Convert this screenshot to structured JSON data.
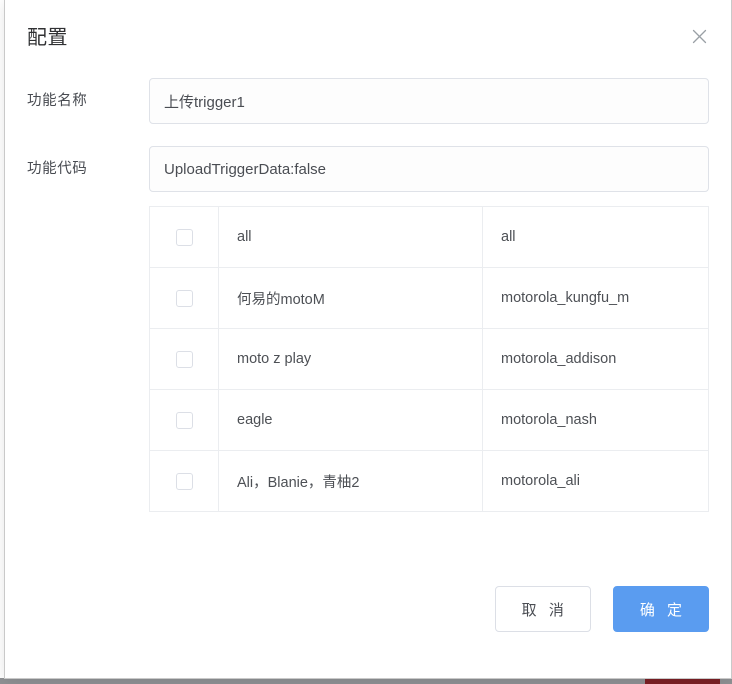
{
  "dialog": {
    "title": "配置",
    "close_icon": "close-icon"
  },
  "form": {
    "fields": [
      {
        "label": "功能名称",
        "value": "上传trigger1",
        "placeholder": "请输入功能名称",
        "name": "function-name"
      },
      {
        "label": "功能代码",
        "value": "UploadTriggerData:false",
        "placeholder": "请输入功能代码",
        "name": "function-code"
      }
    ]
  },
  "table": {
    "rows": [
      {
        "checked": false,
        "name": "all",
        "code": "all"
      },
      {
        "checked": false,
        "name": "何易的motoM",
        "code": "motorola_kungfu_m"
      },
      {
        "checked": false,
        "name": "moto z play",
        "code": "motorola_addison"
      },
      {
        "checked": false,
        "name": "eagle",
        "code": "motorola_nash"
      },
      {
        "checked": false,
        "name": "Ali，Blanie，青柚2",
        "code": "motorola_ali"
      }
    ]
  },
  "footer": {
    "cancel_label": "取 消",
    "confirm_label": "确 定"
  },
  "colors": {
    "primary": "#5a9cf0",
    "border": "#dcdfe6",
    "table_border": "#ebedf0",
    "text": "#4d5055",
    "title": "#303133",
    "taskbar_active": "#7c1f24"
  }
}
